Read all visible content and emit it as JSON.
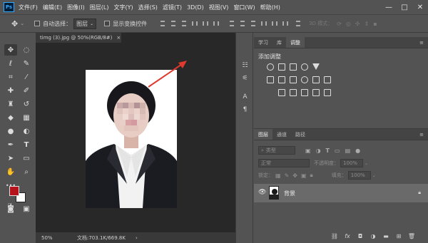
{
  "app": {
    "logo": "Ps"
  },
  "menu": [
    "文件(F)",
    "编辑(E)",
    "图像(I)",
    "图层(L)",
    "文字(Y)",
    "选择(S)",
    "滤镜(T)",
    "3D(D)",
    "视图(V)",
    "窗口(W)",
    "帮助(H)"
  ],
  "window_controls": {
    "minimize": "—",
    "restore": "□",
    "close": "✕"
  },
  "options": {
    "auto_select_label": "自动选择：",
    "auto_select_value": "图层",
    "transform_label": "显示变换控件",
    "mode_3d": "3D 模式："
  },
  "document": {
    "tab_title": "timg (3).jpg @ 50%(RGB/8#)",
    "tab_close": "×",
    "zoom": "50%",
    "doc_info": "文档:703.1K/669.8K",
    "arrow_color": "#e03a2f"
  },
  "colors": {
    "foreground": "#b5121b",
    "background": "#ffffff"
  },
  "adjust_panel": {
    "tabs": [
      "学习",
      "库",
      "调整"
    ],
    "active_tab": "调整",
    "title": "添加调整"
  },
  "layers_panel": {
    "tabs": [
      "图层",
      "通道",
      "路径"
    ],
    "active_tab": "图层",
    "filter_kind": "类型",
    "blend_mode": "正常",
    "opacity_label": "不透明度：",
    "opacity_value": "100%",
    "lock_label": "锁定：",
    "fill_label": "填充：",
    "fill_value": "100%",
    "layers": [
      {
        "name": "背景",
        "visible": true,
        "locked": true
      }
    ]
  }
}
